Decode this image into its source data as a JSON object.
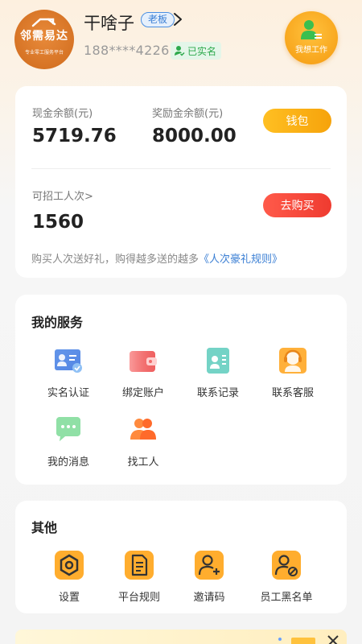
{
  "header": {
    "logo_text": "邻需易达",
    "logo_sub": "专业零工服务平台",
    "username": "干啥子",
    "role_badge": "老板",
    "phone": "188****4226",
    "verified_label": "已实名",
    "switch_label": "我想工作"
  },
  "wallet": {
    "cash_label": "现金余额(元)",
    "cash_value": "5719.76",
    "reward_label": "奖励金余额(元)",
    "reward_value": "8000.00",
    "wallet_button": "钱包",
    "hire_label": "可招工人次>",
    "hire_value": "1560",
    "buy_button": "去购买",
    "promo_text": "购买人次送好礼，购得越多送的越多",
    "promo_link": "《人次豪礼规则》"
  },
  "services": {
    "title": "我的服务",
    "items": [
      {
        "label": "实名认证",
        "icon": "id-card-icon"
      },
      {
        "label": "绑定账户",
        "icon": "wallet-icon"
      },
      {
        "label": "联系记录",
        "icon": "contact-record-icon"
      },
      {
        "label": "联系客服",
        "icon": "customer-service-icon"
      },
      {
        "label": "我的消息",
        "icon": "message-icon"
      },
      {
        "label": "找工人",
        "icon": "find-workers-icon"
      }
    ]
  },
  "others": {
    "title": "其他",
    "items": [
      {
        "label": "设置",
        "icon": "settings-icon"
      },
      {
        "label": "平台规则",
        "icon": "document-icon"
      },
      {
        "label": "邀请码",
        "icon": "invite-user-icon"
      },
      {
        "label": "员工黑名单",
        "icon": "blacklist-user-icon"
      }
    ]
  },
  "colors": {
    "accent_orange": "#f6a30b",
    "accent_red": "#ef3b30",
    "link_blue": "#3b7fd4",
    "verified_green": "#2eaa4d"
  }
}
